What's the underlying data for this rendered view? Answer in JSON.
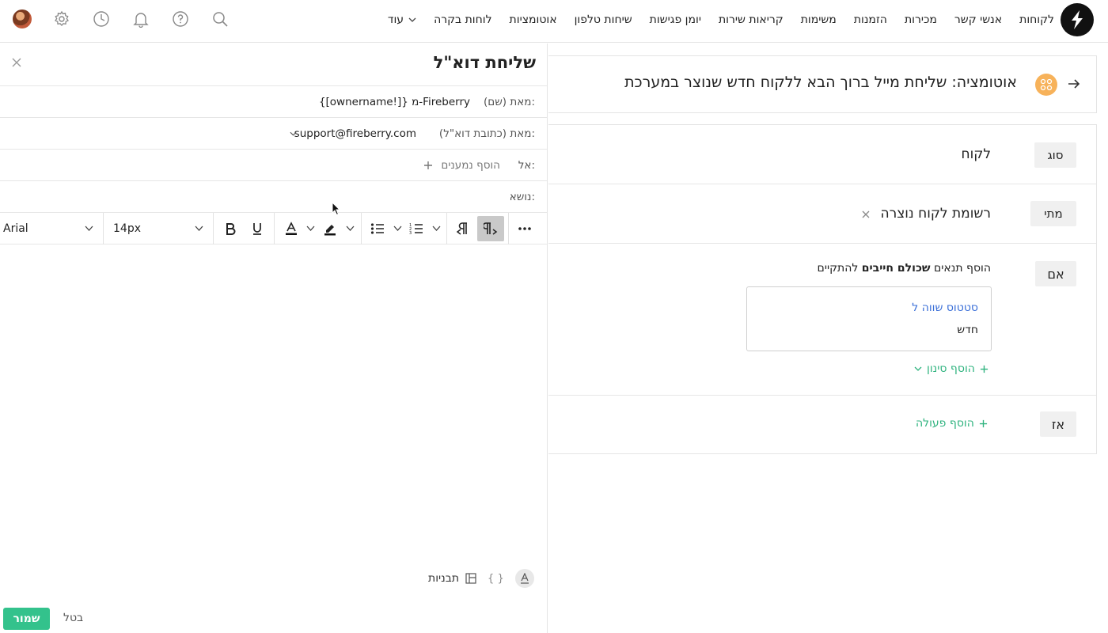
{
  "nav": {
    "items": [
      "לקוחות",
      "אנשי קשר",
      "מכירות",
      "הזמנות",
      "משימות",
      "קריאות שירות",
      "יומן פגישות",
      "שיחות טלפון",
      "אוטומציות",
      "לוחות בקרה"
    ],
    "more_label": "עוד"
  },
  "email": {
    "title": "שליחת דוא\"ל",
    "from_name_label": "מאת (שם):",
    "from_name_value": "{[ownername!]} מ-Fireberry",
    "from_email_label": "מאת (כתובת דוא\"ל):",
    "from_email_value": "support@fireberry.com",
    "to_label": "אל:",
    "add_recipients": "הוסף נמענים",
    "subject_label": "נושא:",
    "font_family": "Arial",
    "font_size": "14px",
    "templates_label": "תבניות",
    "save_label": "שמור",
    "cancel_label": "בטל"
  },
  "automation": {
    "title": "אוטומציה: שליחת מייל ברוך הבא ללקוח חדש שנוצר במערכת",
    "type_badge": "סוג",
    "type_value": "לקוח",
    "when_badge": "מתי",
    "when_value": "רשומת לקוח נוצרה",
    "if_badge": "אם",
    "if_text_prefix": "הוסף תנאים",
    "if_text_bold": "שכולם חייבים",
    "if_text_suffix": "להתקיים",
    "condition_field": "סטטוס שווה ל",
    "condition_value": "חדש",
    "add_filter": "הוסף סינון",
    "then_badge": "אז",
    "add_action": "הוסף פעולה"
  },
  "colors": {
    "accent_green": "#33c28c",
    "link_blue": "#3a6fd8",
    "automation_icon": "#f7b25a"
  }
}
